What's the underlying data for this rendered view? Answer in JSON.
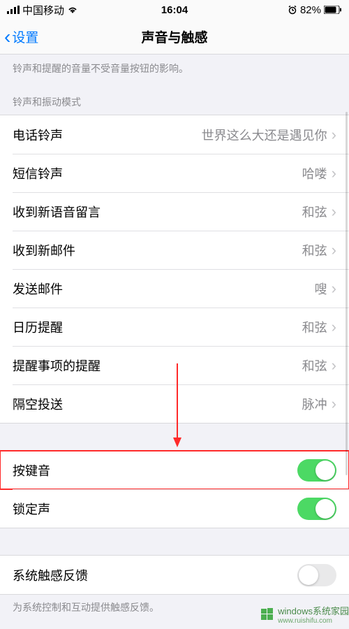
{
  "status": {
    "carrier": "中国移动",
    "time": "16:04",
    "battery": "82%"
  },
  "nav": {
    "back": "设置",
    "title": "声音与触感"
  },
  "captions": {
    "top_note": "铃声和提醒的音量不受音量按钮的影响。",
    "section_header": "铃声和振动模式",
    "haptic_note": "为系统控制和互动提供触感反馈。"
  },
  "rows": {
    "ringtone": {
      "label": "电话铃声",
      "value": "世界这么大还是遇见你"
    },
    "texttone": {
      "label": "短信铃声",
      "value": "哈喽"
    },
    "voicemail": {
      "label": "收到新语音留言",
      "value": "和弦"
    },
    "mail": {
      "label": "收到新邮件",
      "value": "和弦"
    },
    "sentmail": {
      "label": "发送邮件",
      "value": "嗖"
    },
    "calendar": {
      "label": "日历提醒",
      "value": "和弦"
    },
    "reminder": {
      "label": "提醒事项的提醒",
      "value": "和弦"
    },
    "airdrop": {
      "label": "隔空投送",
      "value": "脉冲"
    }
  },
  "toggles": {
    "keyboard": {
      "label": "按键音",
      "on": true
    },
    "lock": {
      "label": "锁定声",
      "on": true
    },
    "haptic": {
      "label": "系统触感反馈",
      "on": false
    }
  },
  "watermark": {
    "brand": "windows系统家园",
    "url": "www.ruishifu.com"
  }
}
